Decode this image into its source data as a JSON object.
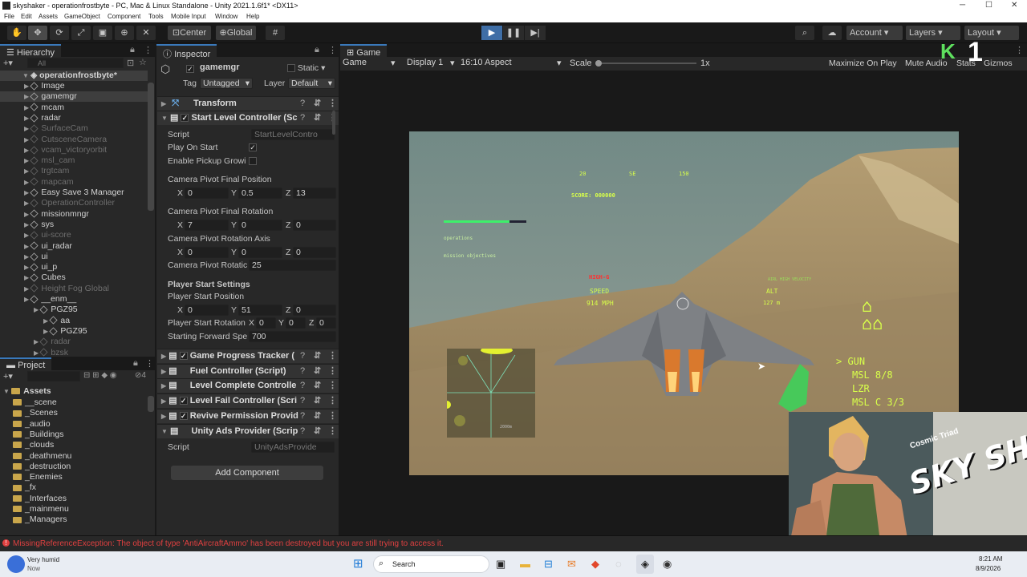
{
  "window": {
    "title": "skyshaker - operationfrostbyte - PC, Mac & Linux Standalone - Unity 2021.1.6f1* <DX11>"
  },
  "menu": [
    "File",
    "Edit",
    "Assets",
    "GameObject",
    "Component",
    "Tools",
    "Mobile Input",
    "Window",
    "Help"
  ],
  "toolbar": {
    "center": "Center",
    "global": "Global",
    "account": "Account",
    "layers": "Layers",
    "layout": "Layout"
  },
  "hierarchy": {
    "tab": "Hierarchy",
    "search_placeholder": "All",
    "scene": "operationfrostbyte*",
    "items": [
      {
        "label": "Image",
        "dim": false,
        "indent": 1
      },
      {
        "label": "gamemgr",
        "dim": false,
        "indent": 1
      },
      {
        "label": "mcam",
        "dim": false,
        "indent": 1
      },
      {
        "label": "radar",
        "dim": false,
        "indent": 1
      },
      {
        "label": "SurfaceCam",
        "dim": true,
        "indent": 1
      },
      {
        "label": "CutsceneCamera",
        "dim": true,
        "indent": 1
      },
      {
        "label": "vcam_victoryorbit",
        "dim": true,
        "indent": 1
      },
      {
        "label": "msl_cam",
        "dim": true,
        "indent": 1
      },
      {
        "label": "trgtcam",
        "dim": true,
        "indent": 1
      },
      {
        "label": "mapcam",
        "dim": true,
        "indent": 1
      },
      {
        "label": "Easy Save 3 Manager",
        "dim": false,
        "indent": 1
      },
      {
        "label": "OperationController",
        "dim": true,
        "indent": 1
      },
      {
        "label": "missionmngr",
        "dim": false,
        "indent": 1
      },
      {
        "label": "sys",
        "dim": false,
        "indent": 1
      },
      {
        "label": "ui-score",
        "dim": true,
        "indent": 1
      },
      {
        "label": "ui_radar",
        "dim": false,
        "indent": 1
      },
      {
        "label": "ui",
        "dim": false,
        "indent": 1
      },
      {
        "label": "ui_p",
        "dim": false,
        "indent": 1
      },
      {
        "label": "Cubes",
        "dim": false,
        "indent": 1
      },
      {
        "label": "Height Fog Global",
        "dim": true,
        "indent": 1
      },
      {
        "label": "__enm__",
        "dim": false,
        "indent": 1
      },
      {
        "label": "PGZ95",
        "dim": false,
        "indent": 2
      },
      {
        "label": "aa",
        "dim": false,
        "indent": 3
      },
      {
        "label": "PGZ95",
        "dim": false,
        "indent": 3
      },
      {
        "label": "radar",
        "dim": true,
        "indent": 2
      },
      {
        "label": "bzsk",
        "dim": true,
        "indent": 2
      }
    ]
  },
  "project": {
    "tab": "Project",
    "root": "Assets",
    "items": [
      "__scene",
      "_Scenes",
      "_audio",
      "_Buildings",
      "_clouds",
      "_deathmenu",
      "_destruction",
      "_Enemies",
      "_fx",
      "_Interfaces",
      "_mainmenu",
      "_Managers"
    ],
    "hidden_count": "4"
  },
  "inspector": {
    "tab": "Inspector",
    "object_name": "gamemgr",
    "static_label": "Static",
    "tag_label": "Tag",
    "tag_value": "Untagged",
    "layer_label": "Layer",
    "layer_value": "Default",
    "transform": "Transform",
    "start_level": "Start Level Controller (Sc",
    "script_label": "Script",
    "script_value": "StartLevelContro",
    "play_on_start": "Play On Start",
    "enable_pickup": "Enable Pickup Growi",
    "cam_final_pos": "Camera Pivot Final Position",
    "cam_final_pos_v": [
      "0",
      "0.5",
      "13"
    ],
    "cam_final_rot": "Camera Pivot Final Rotation",
    "cam_final_rot_v": [
      "7",
      "0",
      "0"
    ],
    "cam_rot_axis": "Camera Pivot Rotation Axis",
    "cam_rot_axis_v": [
      "0",
      "0",
      "0"
    ],
    "cam_rot_label": "Camera Pivot Rotatic",
    "cam_rot_value": "25",
    "player_settings": "Player Start Settings",
    "player_pos": "Player Start Position",
    "player_pos_v": [
      "0",
      "51",
      "0"
    ],
    "player_rot": "Player Start Rotation",
    "player_rot_v": [
      "0",
      "0",
      "0"
    ],
    "fwd_label": "Starting Forward Spe",
    "fwd_value": "700",
    "components": [
      {
        "label": "Game Progress Tracker (",
        "check": true
      },
      {
        "label": "Fuel Controller (Script)",
        "check": false
      },
      {
        "label": "Level Complete Controlle",
        "check": false
      },
      {
        "label": "Level Fail Controller (Scri",
        "check": true
      },
      {
        "label": "Revive Permission Provid",
        "check": true
      },
      {
        "label": "Unity Ads Provider (Scrip",
        "check": false
      }
    ],
    "ads_script": "UnityAdsProvide",
    "add_component": "Add Component"
  },
  "game": {
    "tab": "Game",
    "mode": "Game",
    "display": "Display 1",
    "aspect": "16:10 Aspect",
    "scale_label": "Scale",
    "scale_value": "1x",
    "maximize": "Maximize On Play",
    "mute": "Mute Audio",
    "stats": "Stats",
    "gizmos": "Gizmos"
  },
  "hud": {
    "compass": [
      "20",
      "SE",
      "150"
    ],
    "score": "SCORE: 000000",
    "ops": "operations",
    "mission": "mission objectives",
    "warn": "HIGH-G",
    "speed_label": "SPEED",
    "speed_value": "914 MPH",
    "alt_label": "ALT",
    "alt_value": "127 m",
    "ready": "AIRL HIGH VELOCITY",
    "gun": "> GUN",
    "msl": "MSL 8/8",
    "lzr": "LZR",
    "mslc": "MSL C 3/3",
    "radar_range": "2000m",
    "fuel_fraction": 0.8
  },
  "overlay": {
    "channel_num": "1",
    "title_art": "SKY SHAKER",
    "subtitle": "Cosmic Triad"
  },
  "console": {
    "error": "MissingReferenceException: The object of type 'AntiAircraftAmmo' has been destroyed but you are still trying to access it."
  },
  "taskbar": {
    "weather": "Very humid",
    "weather_sub": "Now",
    "search": "Search",
    "time": "8:21 AM",
    "date": "8/9/2026"
  },
  "colors": {
    "accent": "#3a79bb",
    "hud": "#d8ff4a",
    "error": "#e04040"
  }
}
